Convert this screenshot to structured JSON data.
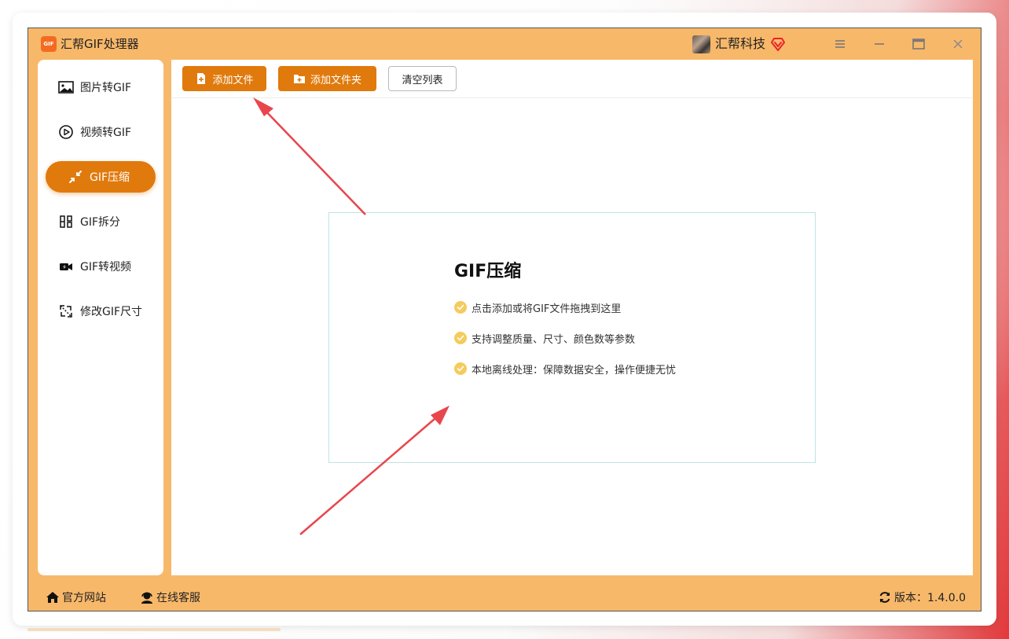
{
  "app": {
    "logo_text": "GIF",
    "title": "汇帮GIF处理器"
  },
  "header": {
    "brand_name": "汇帮科技"
  },
  "sidebar": {
    "items": [
      {
        "label": "图片转GIF",
        "icon": "image-icon",
        "active": false
      },
      {
        "label": "视频转GIF",
        "icon": "play-circle-icon",
        "active": false
      },
      {
        "label": "GIF压缩",
        "icon": "compress-icon",
        "active": true
      },
      {
        "label": "GIF拆分",
        "icon": "split-icon",
        "active": false
      },
      {
        "label": "GIF转视频",
        "icon": "video-camera-icon",
        "active": false
      },
      {
        "label": "修改GIF尺寸",
        "icon": "resize-icon",
        "active": false
      }
    ]
  },
  "toolbar": {
    "add_file_label": "添加文件",
    "add_folder_label": "添加文件夹",
    "clear_list_label": "清空列表"
  },
  "drop_zone": {
    "title": "GIF压缩",
    "features": [
      "点击添加或将GIF文件拖拽到这里",
      "支持调整质量、尺寸、颜色数等参数",
      "本地离线处理：保障数据安全，操作便捷无忧"
    ]
  },
  "footer": {
    "website_label": "官方网站",
    "support_label": "在线客服",
    "version_label": "版本：1.4.0.0"
  },
  "colors": {
    "window_bg": "#f8b86a",
    "accent": "#e07a0d",
    "annotation_arrow": "#e8464c",
    "check": "#f5cb5c"
  }
}
